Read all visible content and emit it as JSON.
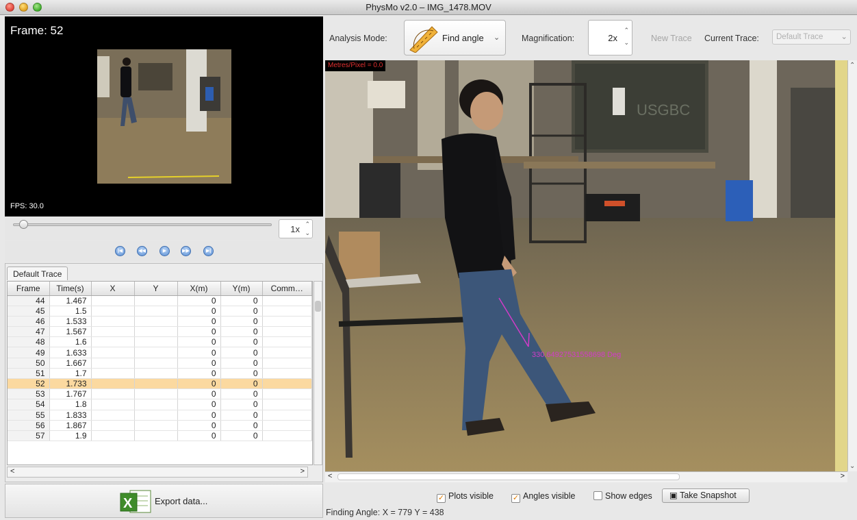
{
  "window": {
    "title": "PhysMo v2.0 – IMG_1478.MOV"
  },
  "player": {
    "frame_label": "Frame: 52",
    "fps_label": "FPS: 30.0",
    "speed": "1x",
    "slider_position": 0.04
  },
  "transport": [
    "first-frame-icon",
    "step-back-icon",
    "play-icon",
    "step-forward-icon",
    "last-frame-icon"
  ],
  "trace_tab": "Default Trace",
  "table": {
    "columns": [
      "Frame",
      "Time(s)",
      "X",
      "Y",
      "X(m)",
      "Y(m)",
      "Comm…"
    ],
    "rows": [
      [
        "44",
        "1.467",
        "",
        "",
        "0",
        "0",
        ""
      ],
      [
        "45",
        "1.5",
        "",
        "",
        "0",
        "0",
        ""
      ],
      [
        "46",
        "1.533",
        "",
        "",
        "0",
        "0",
        ""
      ],
      [
        "47",
        "1.567",
        "",
        "",
        "0",
        "0",
        ""
      ],
      [
        "48",
        "1.6",
        "",
        "",
        "0",
        "0",
        ""
      ],
      [
        "49",
        "1.633",
        "",
        "",
        "0",
        "0",
        ""
      ],
      [
        "50",
        "1.667",
        "",
        "",
        "0",
        "0",
        ""
      ],
      [
        "51",
        "1.7",
        "",
        "",
        "0",
        "0",
        ""
      ],
      [
        "52",
        "1.733",
        "",
        "",
        "0",
        "0",
        ""
      ],
      [
        "53",
        "1.767",
        "",
        "",
        "0",
        "0",
        ""
      ],
      [
        "54",
        "1.8",
        "",
        "",
        "0",
        "0",
        ""
      ],
      [
        "55",
        "1.833",
        "",
        "",
        "0",
        "0",
        ""
      ],
      [
        "56",
        "1.867",
        "",
        "",
        "0",
        "0",
        ""
      ],
      [
        "57",
        "1.9",
        "",
        "",
        "0",
        "0",
        ""
      ]
    ],
    "selected_frame": "52"
  },
  "export": {
    "label": "Export data...",
    "icon": "excel-icon"
  },
  "toolbar": {
    "analysis_mode_label": "Analysis Mode:",
    "analysis_mode_value": "Find angle",
    "analysis_mode_icon": "protractor-icon",
    "magnification_label": "Magnification:",
    "magnification_value": "2x",
    "new_trace": "New Trace",
    "current_trace_label": "Current Trace:",
    "current_trace_value": "Default Trace"
  },
  "scene": {
    "metres_per_pixel": "Metres/Pixel = 0.0",
    "angle_annotation": "330.64927531558698 Deg",
    "annotation_color": "#d23cc8"
  },
  "bottom": {
    "plots_visible": "Plots visible",
    "angles_visible": "Angles visible",
    "show_edges": "Show edges",
    "snapshot": "Take Snapshot",
    "status": "Finding Angle:  X = 779   Y = 438"
  },
  "colors": {
    "selected_row": "#fbd9a0",
    "accent_orange": "#e07b00",
    "video_bg": "#000000"
  }
}
